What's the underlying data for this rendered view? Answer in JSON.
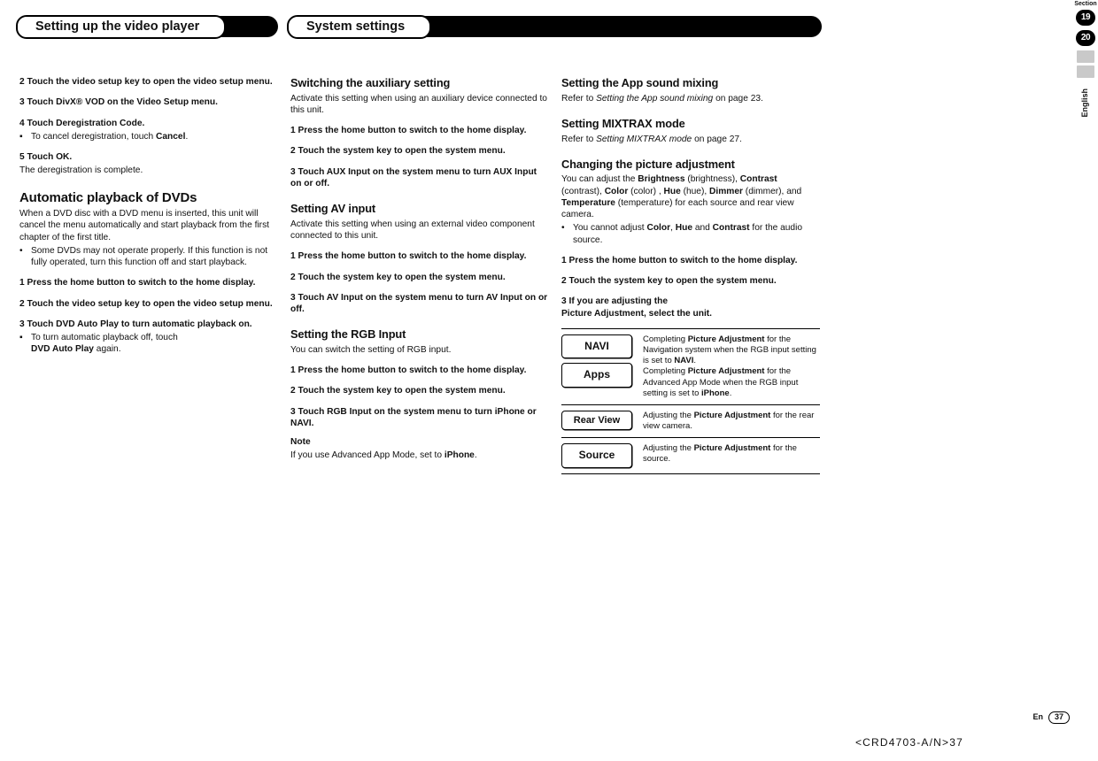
{
  "header1": "Setting up the video player",
  "header2": "System settings",
  "margin": {
    "section": "Section",
    "b1": "19",
    "b2": "20",
    "lang": "English"
  },
  "c1": {
    "s2": "2    Touch the video setup key to open the video setup menu.",
    "s3": "3    Touch DivX® VOD on the Video Setup menu.",
    "s4": "4    Touch Deregistration Code.",
    "s4b": "To cancel deregistration, touch ",
    "s4b_b": "Cancel",
    "s5": "5    Touch OK.",
    "s5p": "The deregistration is complete.",
    "h_auto": "Automatic playback of DVDs",
    "auto_p": "When a DVD disc with a DVD menu is inserted, this unit will cancel the menu automatically and start playback from the first chapter of the first title.",
    "auto_b": "Some DVDs may not operate properly. If this function is not fully operated, turn this function off and start playback.",
    "a1": "1    Press the home button to switch to the home display.",
    "a2": "2    Touch the video setup key to open the video setup menu.",
    "a3": "3    Touch DVD Auto Play to turn automatic playback on.",
    "a3b": "To turn automatic playback off, touch",
    "a3b2": "DVD Auto Play",
    "a3b3": " again."
  },
  "c2": {
    "h_aux": "Switching the auxiliary setting",
    "aux_p": "Activate this setting when using an auxiliary device connected to this unit.",
    "x1": "1    Press the home button to switch to the home display.",
    "x2": "2    Touch the system key to open the system menu.",
    "x3": "3    Touch AUX Input on the system menu to turn AUX Input on or off.",
    "h_av": "Setting AV input",
    "av_p": "Activate this setting when using an external video component connected to this unit.",
    "v1": "1    Press the home button to switch to the home display.",
    "v2": "2    Touch the system key to open the system menu.",
    "v3": "3    Touch AV Input on the system menu to turn AV Input on or off.",
    "h_rgb": "Setting the RGB Input",
    "rgb_p": "You can switch the setting of RGB input.",
    "r1": "1    Press the home button to switch to the home display.",
    "r2": "2    Touch the system key to open the system menu.",
    "r3": "3    Touch RGB Input on the system menu to turn iPhone or NAVI.",
    "note_l": "Note",
    "note_p1": "If you use Advanced App Mode, set to ",
    "note_b": "iPhone"
  },
  "c3": {
    "h_app": "Setting the App sound mixing",
    "app_p1": "Refer to ",
    "app_i": "Setting the App sound mixing",
    "app_p2": " on page 23.",
    "h_mix": "Setting MIXTRAX mode",
    "mix_p1": "Refer to ",
    "mix_i": "Setting MIXTRAX mode",
    "mix_p2": " on page 27.",
    "h_pic": "Changing the picture adjustment",
    "pic_p_1": "You can adjust the ",
    "pic_bri": "Brightness",
    "pic_p_2": " (brightness), ",
    "pic_con": "Contrast",
    "pic_p_3": " (contrast), ",
    "pic_col": "Color",
    "pic_p_4": " (color) , ",
    "pic_hue": "Hue",
    "pic_p_5": " (hue), ",
    "pic_dim": "Dimmer",
    "pic_p_6": " (dimmer), and ",
    "pic_tmp": "Temperature",
    "pic_p_7": " (temperature) for each source and rear view camera.",
    "pic_b1a": "You cannot adjust ",
    "pic_b1b": "Color",
    "pic_b1c": ", ",
    "pic_b1d": "Hue",
    "pic_b1e": " and ",
    "pic_b1f": "Contrast",
    "pic_b1g": " for the audio source.",
    "p1": "1    Press the home button to switch to the home display.",
    "p2": "2    Touch the system key to open the system menu.",
    "p3a": "3    If you are adjusting the",
    "p3b": "Picture Adjustment, select the unit.",
    "tbl": {
      "navi": "NAVI",
      "apps": "Apps",
      "r1a": "Completing ",
      "r1b": "Picture Adjustment",
      "r1c": " for the Navigation system when the RGB input setting is set to ",
      "r1d": "NAVI",
      "r1e": ".",
      "r1f": "Completing ",
      "r1g": "Picture Adjustment",
      "r1h": " for the Advanced App Mode when the RGB input setting is set to ",
      "r1i": "iPhone",
      "r1j": ".",
      "rear": "Rear View",
      "r2a": "Adjusting the ",
      "r2b": "Picture Adjustment",
      "r2c": " for the rear view camera.",
      "src": "Source",
      "r3a": "Adjusting the ",
      "r3b": "Picture Adjustment",
      "r3c": " for the source."
    }
  },
  "footer": {
    "en": "En",
    "page": "37",
    "docid": "<CRD4703-A/N>37"
  }
}
